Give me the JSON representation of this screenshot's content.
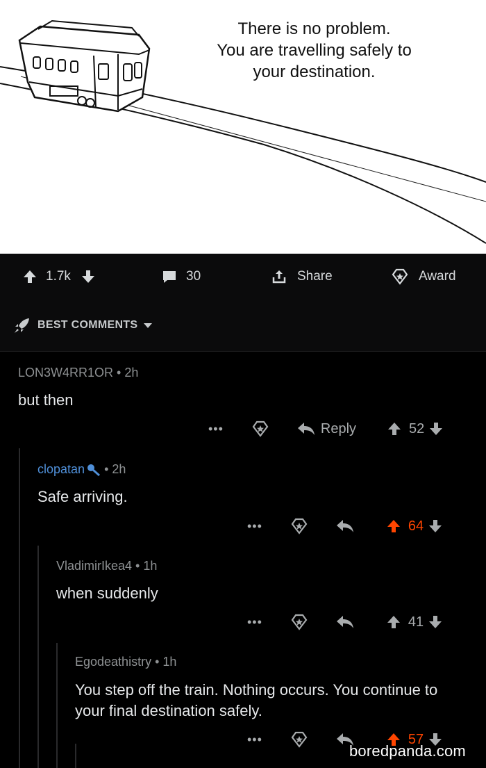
{
  "meme": {
    "caption": "There is no problem.\nYou are travelling safely to\nyour destination."
  },
  "post": {
    "upvotes": "1.7k",
    "comments": "30",
    "share_label": "Share",
    "award_label": "Award",
    "sort_label": "BEST COMMENTS"
  },
  "comments": [
    {
      "author": "LON3W4RR1OR",
      "time": "2h",
      "body": "but then",
      "reply_label": "Reply",
      "score": "52"
    },
    {
      "author": "clopatan",
      "time": "2h",
      "body": "Safe arriving.",
      "score": "64"
    },
    {
      "author": "VladimirIkea4",
      "time": "1h",
      "body": "when suddenly",
      "score": "41"
    },
    {
      "author": "Egodeathistry",
      "time": "1h",
      "body": "You step off the train. Nothing occurs. You continue to your final destination safely.",
      "score": "57"
    }
  ],
  "watermark": "boredpanda.com",
  "colors": {
    "upvoted": "#ff4500",
    "flair_blue": "#4f8fd8"
  }
}
